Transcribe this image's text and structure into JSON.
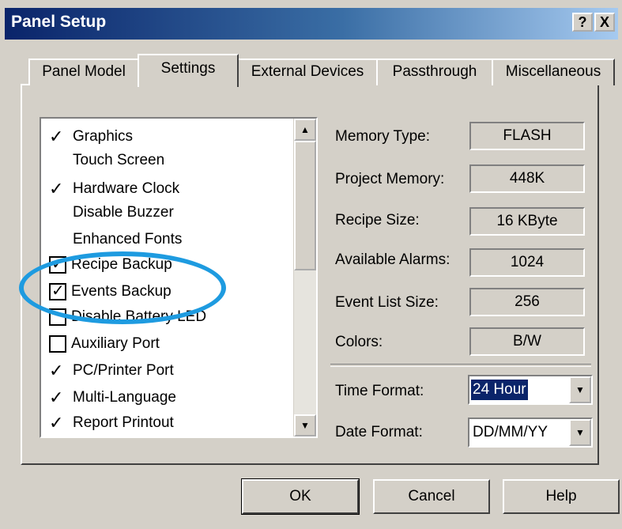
{
  "window": {
    "title": "Panel Setup",
    "help_button": "?",
    "close_button": "X"
  },
  "tabs": [
    {
      "label": "Panel Model",
      "active": false
    },
    {
      "label": "Settings",
      "active": true
    },
    {
      "label": "External Devices",
      "active": false
    },
    {
      "label": "Passthrough",
      "active": false
    },
    {
      "label": "Miscellaneous",
      "active": false
    }
  ],
  "features": [
    {
      "label": "Graphics",
      "state": "check-mark"
    },
    {
      "label": "Touch Screen",
      "state": "none"
    },
    {
      "label": "Hardware Clock",
      "state": "check-mark"
    },
    {
      "label": "Disable Buzzer",
      "state": "none"
    },
    {
      "label": "Enhanced Fonts",
      "state": "none"
    },
    {
      "label": "Recipe Backup",
      "state": "checkbox-checked"
    },
    {
      "label": "Events Backup",
      "state": "checkbox-checked"
    },
    {
      "label": "Disable Battery LED",
      "state": "checkbox-unchecked"
    },
    {
      "label": "Auxiliary Port",
      "state": "checkbox-unchecked"
    },
    {
      "label": "PC/Printer Port",
      "state": "check-mark"
    },
    {
      "label": "Multi-Language",
      "state": "check-mark"
    },
    {
      "label": "Report Printout",
      "state": "check-mark"
    }
  ],
  "info": {
    "memory_type_label": "Memory Type:",
    "memory_type_value": "FLASH",
    "project_memory_label": "Project Memory:",
    "project_memory_value": "448K",
    "recipe_size_label": "Recipe Size:",
    "recipe_size_value": "16 KByte",
    "available_alarms_label": "Available Alarms:",
    "available_alarms_value": "1024",
    "event_list_size_label": "Event List Size:",
    "event_list_size_value": "256",
    "colors_label": "Colors:",
    "colors_value": "B/W"
  },
  "formats": {
    "time_format_label": "Time Format:",
    "time_format_value": "24 Hour",
    "date_format_label": "Date Format:",
    "date_format_value": "DD/MM/YY"
  },
  "buttons": {
    "ok": "OK",
    "cancel": "Cancel",
    "help": "Help"
  },
  "colors": {
    "highlight_circle": "#1e9be0",
    "selection": "#0a246a"
  }
}
